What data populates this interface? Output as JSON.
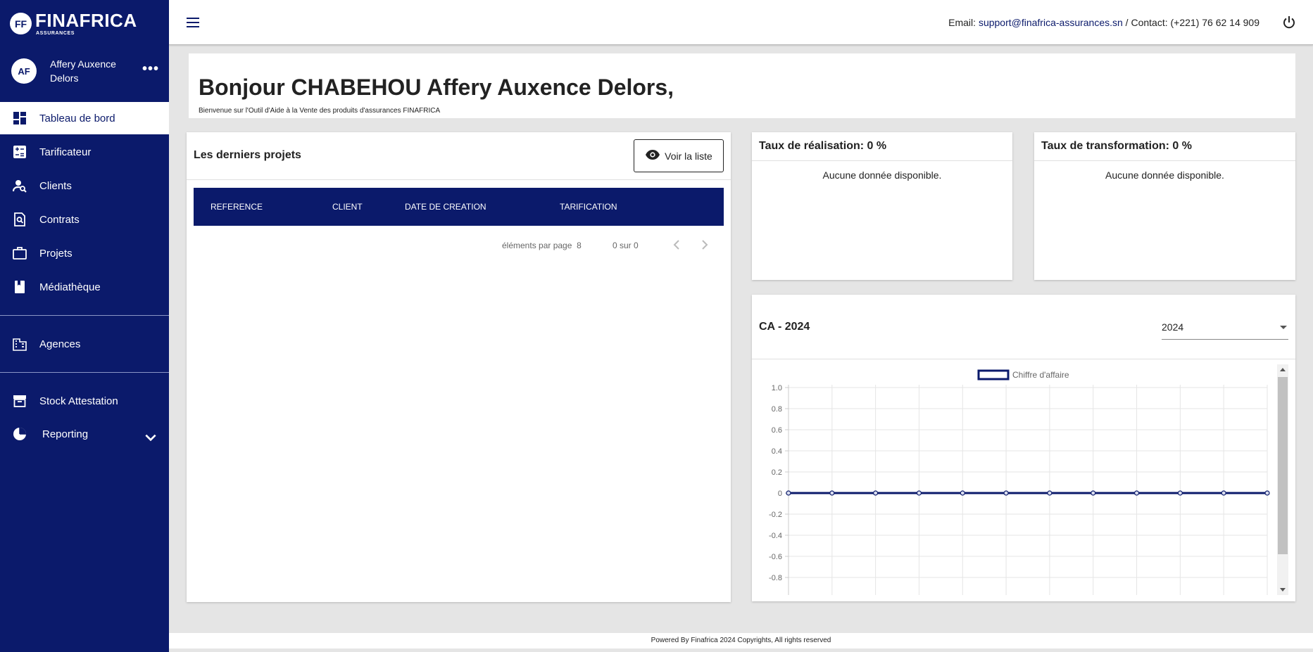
{
  "brand": {
    "logo_mark": "FF",
    "name": "FINAFRICA",
    "sub": "ASSURANCES"
  },
  "user": {
    "initials": "AF",
    "name": "Affery Auxence Delors"
  },
  "nav": {
    "items": [
      {
        "label": "Tableau de bord",
        "icon": "dashboard-icon"
      },
      {
        "label": "Tarificateur",
        "icon": "calculator-icon"
      },
      {
        "label": "Clients",
        "icon": "person-search-icon"
      },
      {
        "label": "Contrats",
        "icon": "document-search-icon"
      },
      {
        "label": "Projets",
        "icon": "briefcase-icon"
      },
      {
        "label": "Médiathèque",
        "icon": "book-icon"
      },
      {
        "label": "Agences",
        "icon": "building-icon"
      },
      {
        "label": "Stock Attestation",
        "icon": "archive-icon"
      },
      {
        "label": "Reporting",
        "icon": "pie-chart-icon"
      }
    ]
  },
  "topbar": {
    "email_label": "Email: ",
    "email": "support@finafrica-assurances.sn",
    "contact": " / Contact: (+221) 76 62 14 909"
  },
  "welcome": {
    "title": "Bonjour CHABEHOU Affery Auxence Delors,",
    "subtitle": "Bienvenue sur l'Outil d'Aide à la Vente des produits d'assurances FINAFRICA"
  },
  "projects": {
    "title": "Les derniers projets",
    "button": "Voir la liste",
    "columns": [
      "REFERENCE",
      "CLIENT",
      "DATE DE CREATION",
      "TARIFICATION"
    ],
    "rows": [],
    "per_page_label": "éléments par page",
    "per_page": "8",
    "range": "0 sur 0"
  },
  "realisation": {
    "title": "Taux de réalisation: 0 %",
    "empty": "Aucune donnée disponible."
  },
  "transformation": {
    "title": "Taux de transformation: 0 %",
    "empty": "Aucune donnée disponible."
  },
  "ca": {
    "title": "CA - 2024",
    "year": "2024"
  },
  "chart_data": {
    "type": "line",
    "title": "",
    "legend": "top",
    "grid": true,
    "categories": [
      "",
      "",
      "",
      "",
      "",
      "",
      "",
      "",
      "",
      "",
      "",
      ""
    ],
    "series": [
      {
        "name": "Chiffre d'affaire",
        "values": [
          0,
          0,
          0,
          0,
          0,
          0,
          0,
          0,
          0,
          0,
          0,
          0
        ],
        "color": "#0b1a6b"
      }
    ],
    "ylim": [
      -1.0,
      1.0
    ],
    "yticks": [
      "1.0",
      "0.8",
      "0.6",
      "0.4",
      "0.2",
      "0",
      "-0.2",
      "-0.4",
      "-0.6",
      "-0.8"
    ]
  },
  "footer": "Powered By Finafrica 2024 Copyrights, All rights reserved",
  "colors": {
    "primary": "#0b1a6b",
    "background": "#e5e5e5"
  }
}
